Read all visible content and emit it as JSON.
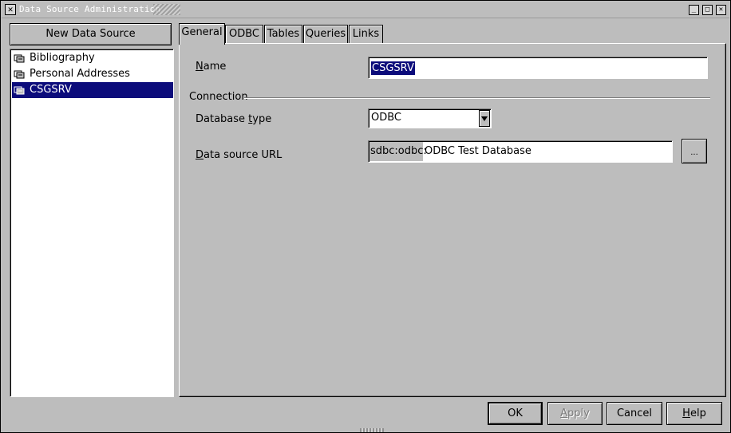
{
  "window": {
    "title": "Data Source Administration",
    "close_glyph": "✕",
    "minimize_glyph": "_",
    "maximize_glyph": "□",
    "close2_glyph": "✕"
  },
  "left": {
    "new_button": "New Data Source",
    "items": [
      {
        "label": "Bibliography",
        "icon": "database-icon",
        "selected": false
      },
      {
        "label": "Personal Addresses",
        "icon": "database-icon",
        "selected": false
      },
      {
        "label": "CSGSRV",
        "icon": "database-icon",
        "selected": true
      }
    ]
  },
  "tabs": [
    {
      "label": "General",
      "active": true
    },
    {
      "label": "ODBC",
      "active": false
    },
    {
      "label": "Tables",
      "active": false
    },
    {
      "label": "Queries",
      "active": false
    },
    {
      "label": "Links",
      "active": false
    }
  ],
  "general": {
    "name_label_u": "N",
    "name_label_rest": "ame",
    "name_value": "CSGSRV",
    "connection_label": "Connection",
    "dbtype_label_pre": "Database ",
    "dbtype_label_u": "t",
    "dbtype_label_rest": "ype",
    "dbtype_value": "ODBC",
    "url_label_u": "D",
    "url_label_rest": "ata source URL",
    "url_prefix": "sdbc:odbc:",
    "url_value": "ODBC Test Database",
    "browse_label": "..."
  },
  "buttons": {
    "ok": "OK",
    "apply_u": "A",
    "apply_rest": "pply",
    "cancel": "Cancel",
    "help_u": "H",
    "help_rest": "elp"
  }
}
